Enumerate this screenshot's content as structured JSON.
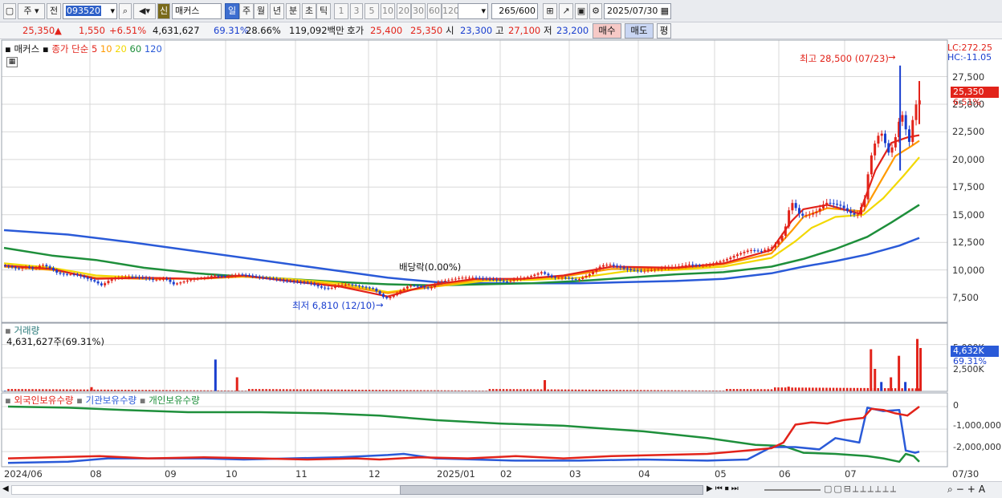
{
  "toolbar": {
    "btn_main": "주",
    "btn_prev": "전",
    "code": "093520",
    "badge": "신",
    "stock_name": "매커스",
    "periods": [
      "일",
      "주",
      "월",
      "년",
      "분",
      "초",
      "틱"
    ],
    "numbers": [
      "1",
      "3",
      "5",
      "10",
      "20",
      "30",
      "60",
      "120"
    ],
    "count": "265",
    "count_total": "/600",
    "date": "2025/07/30"
  },
  "info": {
    "price": "25,350",
    "change": "1,550",
    "change_pct": "+6.51%",
    "volume": "4,631,627",
    "vol_ratio": "69.31%",
    "turnover": "28.66%",
    "amount": "119,092백만",
    "ask_label": "호가",
    "ask1": "25,400",
    "ask2": "25,350",
    "open_label": "시",
    "open": "23,300",
    "high_label": "고",
    "high": "27,100",
    "low_label": "저",
    "low": "23,200",
    "buy": "매수",
    "sell": "매도",
    "eval": "평"
  },
  "legend": {
    "name": "매커스",
    "ma_label": "종가 단순",
    "ma": [
      {
        "label": "5",
        "color": "#e2231a"
      },
      {
        "label": "10",
        "color": "#ff9a00"
      },
      {
        "label": "20",
        "color": "#f2d800"
      },
      {
        "label": "60",
        "color": "#1e8f3b"
      },
      {
        "label": "120",
        "color": "#2a5ad8"
      }
    ]
  },
  "right_top": {
    "lc": "LC:272.25",
    "hc": "HC:-11.05"
  },
  "y_ticks": [
    "27,500",
    "25,000",
    "22,500",
    "20,000",
    "17,500",
    "15,000",
    "12,500",
    "10,000",
    "7,500"
  ],
  "price_tag": {
    "price": "25,350",
    "pct": "6.51%"
  },
  "annotations": {
    "high": "최고 28,500 (07/23)",
    "low": "최저 6,810 (12/10)",
    "dividend": "배당락(0.00%)"
  },
  "volume_panel": {
    "title": "거래량",
    "value": "4,631,627주(69.31%)",
    "ticks": [
      "5,000K",
      "2,500K"
    ],
    "tag": "4,632K",
    "tag_pct": "69.31%"
  },
  "holdings_panel": {
    "legend": [
      {
        "label": "외국인보유수량",
        "color": "#e2231a"
      },
      {
        "label": "기관보유수량",
        "color": "#2a5ad8"
      },
      {
        "label": "개인보유수량",
        "color": "#1e8f3b"
      }
    ],
    "ticks": [
      "0",
      "-1,000,000",
      "-2,000,000"
    ]
  },
  "x_labels": [
    "2024/06",
    "08",
    "09",
    "10",
    "11",
    "12",
    "2025/01",
    "02",
    "03",
    "04",
    "05",
    "06",
    "07",
    "07/30"
  ],
  "chart_data": {
    "type": "candlestick",
    "title": "매커스",
    "ylim": [
      5400,
      29500
    ],
    "y_ticks": [
      7500,
      10000,
      12500,
      15000,
      17500,
      20000,
      22500,
      25000,
      27500
    ],
    "close_series": [
      [
        0,
        10400
      ],
      [
        10,
        10300
      ],
      [
        20,
        10100
      ],
      [
        30,
        10300
      ],
      [
        40,
        10100
      ],
      [
        50,
        10500
      ],
      [
        60,
        10200
      ],
      [
        70,
        9700
      ],
      [
        80,
        9600
      ],
      [
        90,
        9600
      ],
      [
        100,
        9400
      ],
      [
        115,
        9000
      ],
      [
        125,
        8600
      ],
      [
        135,
        9100
      ],
      [
        145,
        9300
      ],
      [
        160,
        9400
      ],
      [
        175,
        9300
      ],
      [
        190,
        9100
      ],
      [
        205,
        9200
      ],
      [
        215,
        8700
      ],
      [
        225,
        8900
      ],
      [
        240,
        9200
      ],
      [
        255,
        9300
      ],
      [
        265,
        9500
      ],
      [
        280,
        9400
      ],
      [
        295,
        9600
      ],
      [
        310,
        9500
      ],
      [
        325,
        9300
      ],
      [
        340,
        9200
      ],
      [
        355,
        9000
      ],
      [
        370,
        8900
      ],
      [
        385,
        8800
      ],
      [
        400,
        8400
      ],
      [
        410,
        8300
      ],
      [
        420,
        8600
      ],
      [
        435,
        8700
      ],
      [
        450,
        8500
      ],
      [
        465,
        8300
      ],
      [
        480,
        7400
      ],
      [
        490,
        7700
      ],
      [
        500,
        8200
      ],
      [
        510,
        8600
      ],
      [
        525,
        8500
      ],
      [
        535,
        8300
      ],
      [
        545,
        8900
      ],
      [
        560,
        9100
      ],
      [
        575,
        9300
      ],
      [
        590,
        9300
      ],
      [
        605,
        9200
      ],
      [
        620,
        9100
      ],
      [
        630,
        8900
      ],
      [
        645,
        9200
      ],
      [
        660,
        9400
      ],
      [
        675,
        9800
      ],
      [
        690,
        9300
      ],
      [
        705,
        9300
      ],
      [
        720,
        9100
      ],
      [
        735,
        9600
      ],
      [
        750,
        10400
      ],
      [
        760,
        10500
      ],
      [
        770,
        10300
      ],
      [
        785,
        10000
      ],
      [
        800,
        9900
      ],
      [
        815,
        10000
      ],
      [
        830,
        10200
      ],
      [
        845,
        10300
      ],
      [
        860,
        10500
      ],
      [
        875,
        10400
      ],
      [
        890,
        10600
      ],
      [
        905,
        10900
      ],
      [
        920,
        11400
      ],
      [
        935,
        11800
      ],
      [
        950,
        11700
      ],
      [
        965,
        12100
      ],
      [
        975,
        12900
      ],
      [
        980,
        13800
      ],
      [
        985,
        15500
      ],
      [
        990,
        16200
      ],
      [
        995,
        15300
      ],
      [
        1000,
        14900
      ],
      [
        1010,
        15000
      ],
      [
        1020,
        15300
      ],
      [
        1030,
        16100
      ],
      [
        1040,
        16000
      ],
      [
        1050,
        15800
      ],
      [
        1060,
        15200
      ],
      [
        1070,
        14900
      ],
      [
        1080,
        16500
      ],
      [
        1085,
        19500
      ],
      [
        1090,
        21000
      ],
      [
        1095,
        22000
      ],
      [
        1100,
        22500
      ],
      [
        1105,
        21500
      ],
      [
        1110,
        20500
      ],
      [
        1115,
        21300
      ],
      [
        1120,
        22500
      ],
      [
        1125,
        24500
      ],
      [
        1130,
        23000
      ],
      [
        1135,
        21500
      ],
      [
        1140,
        23800
      ],
      [
        1145,
        25350
      ]
    ],
    "ma": {
      "5": [
        [
          0,
          10400
        ],
        [
          60,
          10100
        ],
        [
          115,
          9200
        ],
        [
          175,
          9300
        ],
        [
          240,
          9200
        ],
        [
          300,
          9500
        ],
        [
          355,
          9000
        ],
        [
          420,
          8500
        ],
        [
          480,
          7600
        ],
        [
          530,
          8600
        ],
        [
          590,
          9200
        ],
        [
          650,
          9200
        ],
        [
          700,
          9500
        ],
        [
          760,
          10300
        ],
        [
          840,
          10200
        ],
        [
          900,
          10600
        ],
        [
          960,
          11800
        ],
        [
          985,
          14400
        ],
        [
          1000,
          15500
        ],
        [
          1030,
          15900
        ],
        [
          1070,
          15100
        ],
        [
          1090,
          19000
        ],
        [
          1110,
          21500
        ],
        [
          1130,
          22000
        ],
        [
          1145,
          22200
        ]
      ],
      "10": [
        [
          0,
          10300
        ],
        [
          60,
          10000
        ],
        [
          115,
          9300
        ],
        [
          175,
          9200
        ],
        [
          240,
          9200
        ],
        [
          300,
          9400
        ],
        [
          355,
          9100
        ],
        [
          420,
          8600
        ],
        [
          480,
          7900
        ],
        [
          530,
          8400
        ],
        [
          590,
          9100
        ],
        [
          650,
          9200
        ],
        [
          700,
          9400
        ],
        [
          760,
          10100
        ],
        [
          840,
          10100
        ],
        [
          900,
          10500
        ],
        [
          960,
          11500
        ],
        [
          985,
          13500
        ],
        [
          1000,
          14800
        ],
        [
          1030,
          15600
        ],
        [
          1075,
          15300
        ],
        [
          1095,
          17800
        ],
        [
          1115,
          20300
        ],
        [
          1135,
          21200
        ],
        [
          1145,
          21700
        ]
      ],
      "20": [
        [
          0,
          10600
        ],
        [
          60,
          10200
        ],
        [
          115,
          9500
        ],
        [
          175,
          9300
        ],
        [
          240,
          9200
        ],
        [
          300,
          9400
        ],
        [
          355,
          9200
        ],
        [
          420,
          8800
        ],
        [
          480,
          8000
        ],
        [
          540,
          8500
        ],
        [
          600,
          9000
        ],
        [
          660,
          9100
        ],
        [
          720,
          9300
        ],
        [
          780,
          9900
        ],
        [
          840,
          10000
        ],
        [
          900,
          10300
        ],
        [
          960,
          11100
        ],
        [
          990,
          12600
        ],
        [
          1010,
          13800
        ],
        [
          1040,
          14800
        ],
        [
          1075,
          15000
        ],
        [
          1100,
          16500
        ],
        [
          1125,
          18500
        ],
        [
          1145,
          20200
        ]
      ],
      "60": [
        [
          0,
          12000
        ],
        [
          60,
          11300
        ],
        [
          115,
          10900
        ],
        [
          175,
          10200
        ],
        [
          240,
          9700
        ],
        [
          300,
          9400
        ],
        [
          355,
          9200
        ],
        [
          420,
          8900
        ],
        [
          480,
          8700
        ],
        [
          540,
          8600
        ],
        [
          600,
          8700
        ],
        [
          660,
          8800
        ],
        [
          720,
          9000
        ],
        [
          780,
          9300
        ],
        [
          840,
          9600
        ],
        [
          900,
          9800
        ],
        [
          960,
          10300
        ],
        [
          1000,
          11000
        ],
        [
          1040,
          11900
        ],
        [
          1080,
          13000
        ],
        [
          1110,
          14300
        ],
        [
          1145,
          15900
        ]
      ],
      "120": [
        [
          0,
          13600
        ],
        [
          80,
          13200
        ],
        [
          160,
          12500
        ],
        [
          240,
          11700
        ],
        [
          320,
          10900
        ],
        [
          400,
          10100
        ],
        [
          480,
          9300
        ],
        [
          540,
          8900
        ],
        [
          600,
          8800
        ],
        [
          660,
          8800
        ],
        [
          720,
          8800
        ],
        [
          780,
          8900
        ],
        [
          840,
          9000
        ],
        [
          900,
          9200
        ],
        [
          960,
          9700
        ],
        [
          1000,
          10300
        ],
        [
          1040,
          10800
        ],
        [
          1080,
          11400
        ],
        [
          1120,
          12200
        ],
        [
          1145,
          12900
        ]
      ]
    },
    "volume_ylim": [
      0,
      6000
    ],
    "volume_spikes": [
      [
        108,
        450
      ],
      [
        263,
        3400
      ],
      [
        290,
        1500
      ],
      [
        675,
        1200
      ],
      [
        980,
        500
      ],
      [
        1083,
        4500
      ],
      [
        1088,
        2400
      ],
      [
        1096,
        1000
      ],
      [
        1108,
        1500
      ],
      [
        1118,
        3800
      ],
      [
        1126,
        1000
      ],
      [
        1141,
        5600
      ],
      [
        1145,
        4632
      ]
    ],
    "holdings_ylim": [
      -2600000,
      250000
    ],
    "foreign": [
      [
        5,
        -2300000
      ],
      [
        60,
        -2250000
      ],
      [
        120,
        -2200000
      ],
      [
        180,
        -2300000
      ],
      [
        250,
        -2250000
      ],
      [
        320,
        -2300000
      ],
      [
        380,
        -2350000
      ],
      [
        440,
        -2300000
      ],
      [
        470,
        -2350000
      ],
      [
        520,
        -2250000
      ],
      [
        580,
        -2300000
      ],
      [
        640,
        -2200000
      ],
      [
        700,
        -2300000
      ],
      [
        760,
        -2200000
      ],
      [
        820,
        -2150000
      ],
      [
        880,
        -2100000
      ],
      [
        930,
        -1950000
      ],
      [
        960,
        -1850000
      ],
      [
        975,
        -1600000
      ],
      [
        990,
        -800000
      ],
      [
        1010,
        -700000
      ],
      [
        1030,
        -750000
      ],
      [
        1050,
        -600000
      ],
      [
        1075,
        -500000
      ],
      [
        1085,
        -100000
      ],
      [
        1100,
        -150000
      ],
      [
        1115,
        -300000
      ],
      [
        1130,
        -400000
      ],
      [
        1145,
        0
      ]
    ],
    "institution": [
      [
        5,
        -2500000
      ],
      [
        80,
        -2450000
      ],
      [
        130,
        -2300000
      ],
      [
        250,
        -2300000
      ],
      [
        300,
        -2350000
      ],
      [
        420,
        -2250000
      ],
      [
        480,
        -2150000
      ],
      [
        500,
        -2100000
      ],
      [
        540,
        -2300000
      ],
      [
        640,
        -2400000
      ],
      [
        720,
        -2400000
      ],
      [
        800,
        -2350000
      ],
      [
        880,
        -2400000
      ],
      [
        930,
        -2350000
      ],
      [
        960,
        -1800000
      ],
      [
        990,
        -1800000
      ],
      [
        1020,
        -1900000
      ],
      [
        1040,
        -1400000
      ],
      [
        1070,
        -1600000
      ],
      [
        1080,
        -50000
      ],
      [
        1100,
        -200000
      ],
      [
        1120,
        -150000
      ],
      [
        1128,
        -1950000
      ],
      [
        1140,
        -2050000
      ],
      [
        1145,
        -2000000
      ]
    ],
    "individual": [
      [
        5,
        0
      ],
      [
        80,
        -50000
      ],
      [
        150,
        -150000
      ],
      [
        230,
        -250000
      ],
      [
        320,
        -250000
      ],
      [
        400,
        -300000
      ],
      [
        470,
        -400000
      ],
      [
        540,
        -600000
      ],
      [
        620,
        -750000
      ],
      [
        700,
        -850000
      ],
      [
        800,
        -1100000
      ],
      [
        880,
        -1400000
      ],
      [
        940,
        -1700000
      ],
      [
        975,
        -1750000
      ],
      [
        1000,
        -2050000
      ],
      [
        1040,
        -2100000
      ],
      [
        1080,
        -2200000
      ],
      [
        1100,
        -2300000
      ],
      [
        1120,
        -2450000
      ],
      [
        1128,
        -2100000
      ],
      [
        1138,
        -2200000
      ],
      [
        1145,
        -2450000
      ]
    ]
  },
  "colors": {
    "up": "#e2231a",
    "down": "#1a3fcf",
    "accent": "#3d6ed0",
    "grid": "#d9d9d9"
  }
}
